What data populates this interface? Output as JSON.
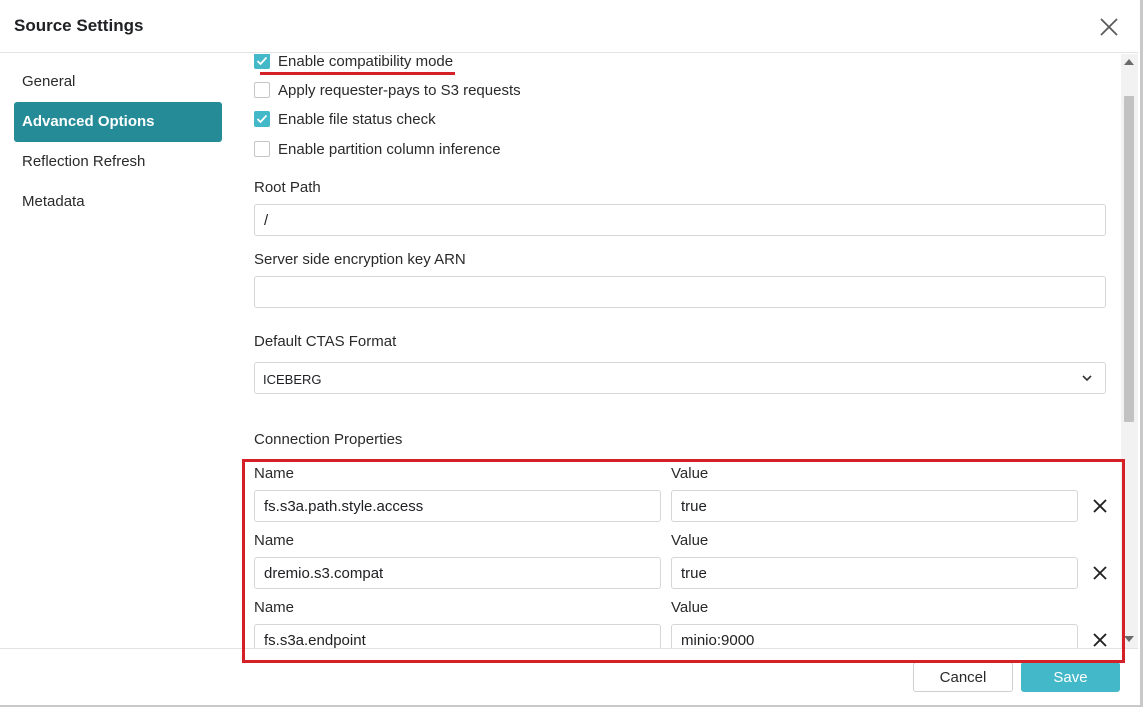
{
  "dialog": {
    "title": "Source Settings",
    "close_icon": "close-icon"
  },
  "sidebar": {
    "items": [
      {
        "label": "General",
        "active": false
      },
      {
        "label": "Advanced Options",
        "active": true
      },
      {
        "label": "Reflection Refresh",
        "active": false
      },
      {
        "label": "Metadata",
        "active": false
      }
    ]
  },
  "options": {
    "checkboxes": [
      {
        "label": "Enable compatibility mode",
        "checked": true
      },
      {
        "label": "Apply requester-pays to S3 requests",
        "checked": false
      },
      {
        "label": "Enable file status check",
        "checked": true
      },
      {
        "label": "Enable partition column inference",
        "checked": false
      }
    ],
    "root_path": {
      "label": "Root Path",
      "value": "/"
    },
    "sse_key": {
      "label": "Server side encryption key ARN",
      "value": ""
    },
    "ctas_format": {
      "label": "Default CTAS Format",
      "value": "ICEBERG"
    }
  },
  "connection_properties": {
    "label": "Connection Properties",
    "name_header": "Name",
    "value_header": "Value",
    "rows": [
      {
        "name": "fs.s3a.path.style.access",
        "value": "true"
      },
      {
        "name": "dremio.s3.compat",
        "value": "true"
      },
      {
        "name": "fs.s3a.endpoint",
        "value": "minio:9000"
      }
    ]
  },
  "footer": {
    "cancel_label": "Cancel",
    "save_label": "Save"
  },
  "colors": {
    "accent": "#248b97",
    "checkbox_checked": "#43b8c9",
    "save_button": "#43b8c9",
    "annotation": "#d42027"
  }
}
